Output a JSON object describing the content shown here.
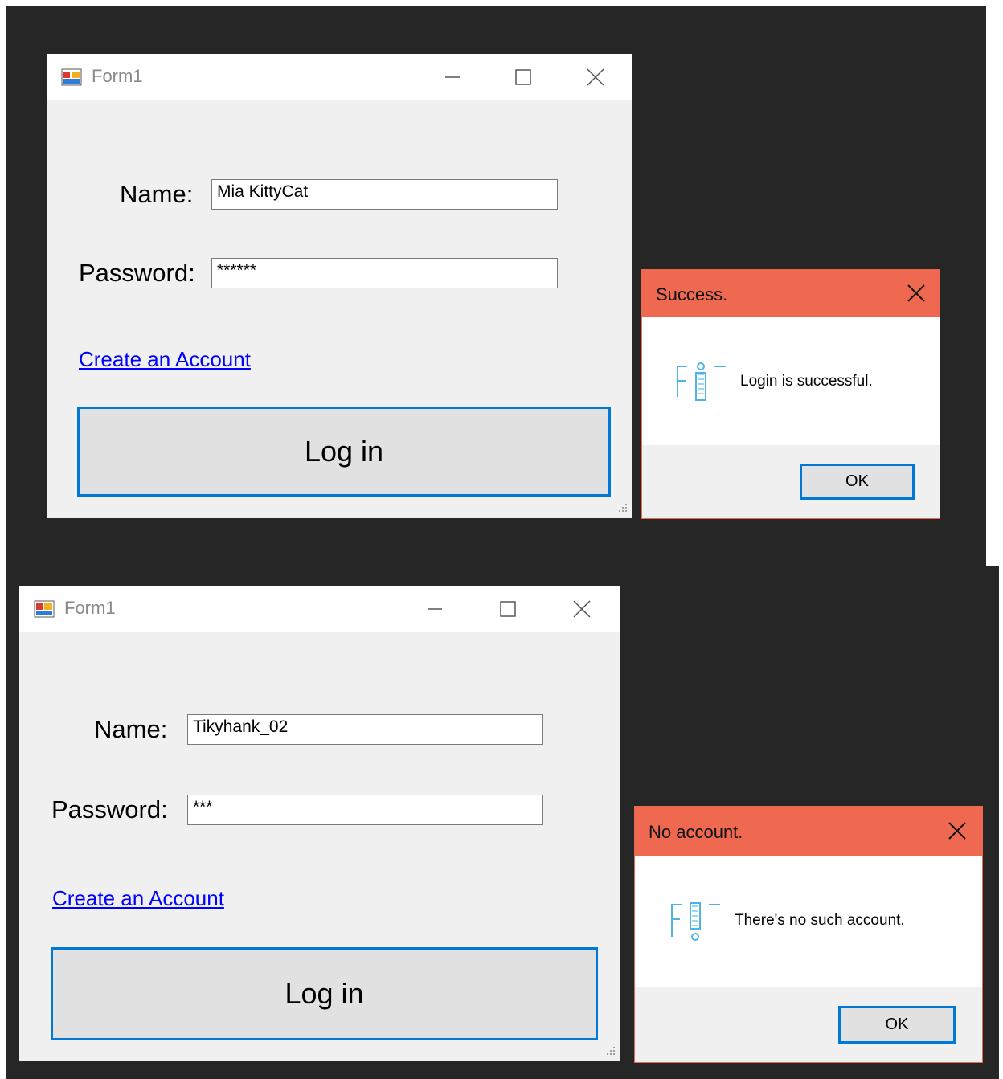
{
  "forms": [
    {
      "title": "Form1",
      "name_label": "Name:",
      "name_value": "Mia KittyCat",
      "password_label": "Password:",
      "password_value": "******",
      "create_account_link": "Create an Account",
      "login_button": "Log in"
    },
    {
      "title": "Form1",
      "name_label": "Name:",
      "name_value": "Tikyhank_02",
      "password_label": "Password:",
      "password_value": "***",
      "create_account_link": "Create an Account",
      "login_button": "Log in"
    }
  ],
  "dialogs": [
    {
      "title": "Success.",
      "message": "Login is successful.",
      "ok_button": "OK",
      "icon": "info-icon"
    },
    {
      "title": "No account.",
      "message": "There's no such account.",
      "ok_button": "OK",
      "icon": "warning-icon"
    }
  ],
  "colors": {
    "dialog_titlebar": "#ef6950",
    "focus_border": "#0078d7",
    "link": "#0000ff",
    "form_background": "#f0f0f0",
    "desktop_background": "#262626"
  }
}
